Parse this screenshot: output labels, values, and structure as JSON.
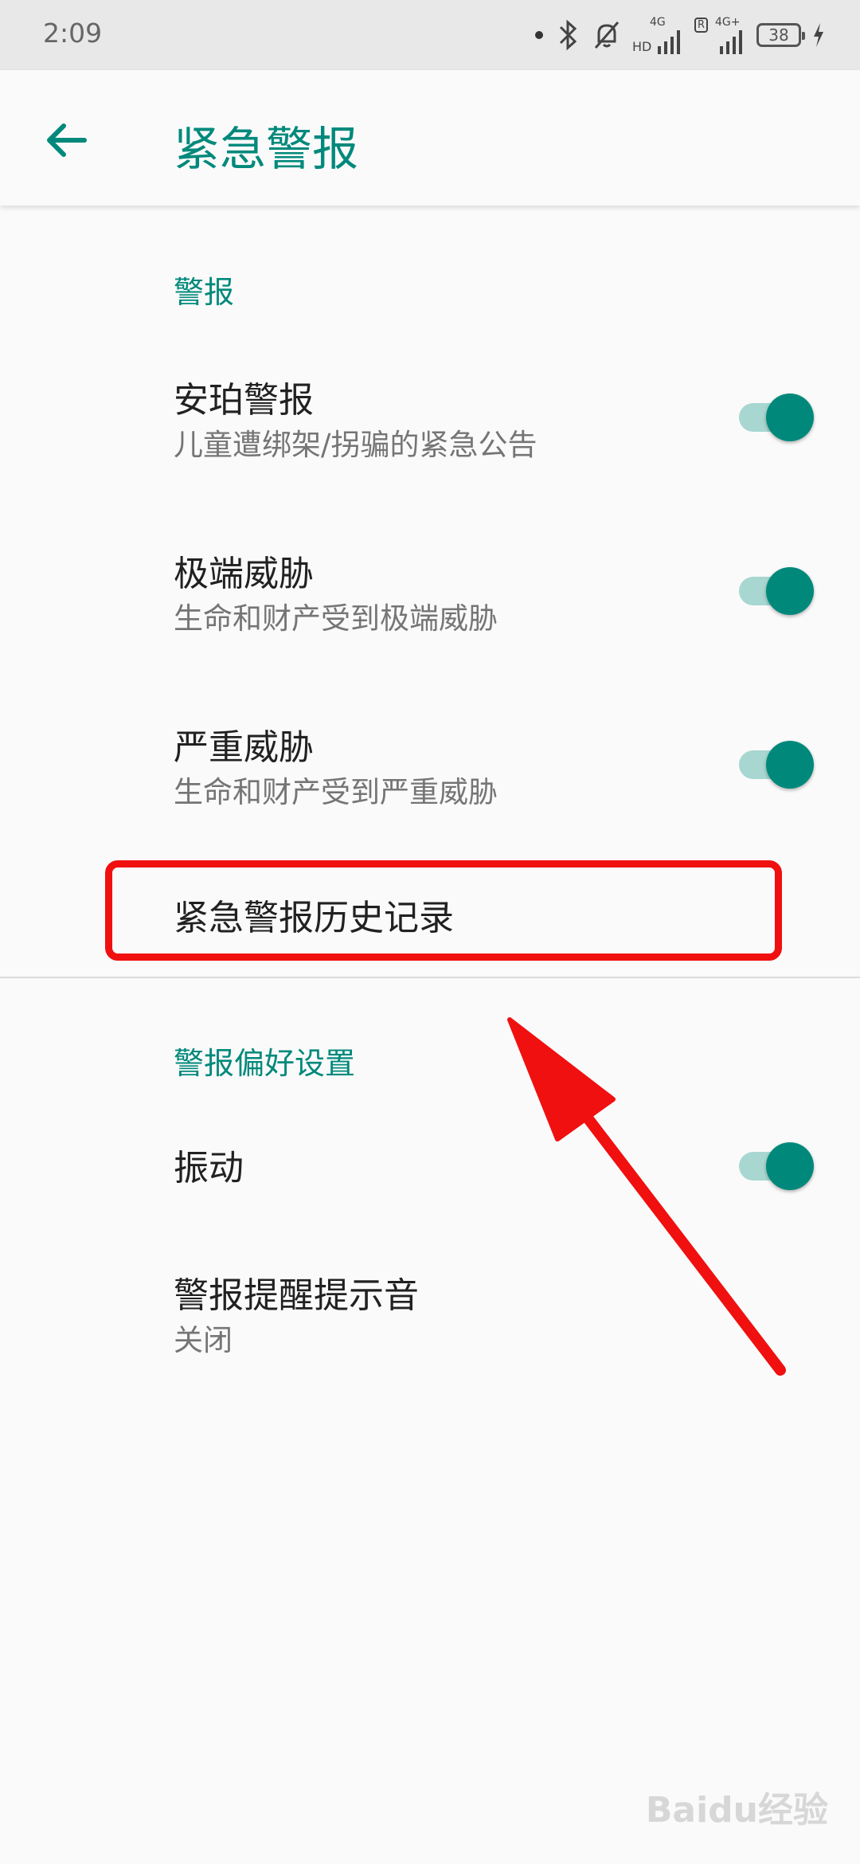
{
  "status_bar": {
    "time": "2:09",
    "battery": "38",
    "network1": "4G",
    "network2": "4G+",
    "hd_label": "HD",
    "roaming_label": "R"
  },
  "app_bar": {
    "title": "紧急警报"
  },
  "sections": {
    "alerts_header": "警报",
    "prefs_header": "警报偏好设置"
  },
  "alerts": [
    {
      "title": "安珀警报",
      "summary": "儿童遭绑架/拐骗的紧急公告",
      "enabled": true
    },
    {
      "title": "极端威胁",
      "summary": "生命和财产受到极端威胁",
      "enabled": true
    },
    {
      "title": "严重威胁",
      "summary": "生命和财产受到严重威胁",
      "enabled": true
    }
  ],
  "history": {
    "title": "紧急警报历史记录"
  },
  "prefs": [
    {
      "title": "振动",
      "enabled": true
    },
    {
      "title": "警报提醒提示音",
      "summary": "关闭"
    }
  ],
  "watermark": "Baidu经验",
  "colors": {
    "accent": "#00897b",
    "switch_track": "#a7d7d0",
    "annotation_red": "#f01010"
  }
}
